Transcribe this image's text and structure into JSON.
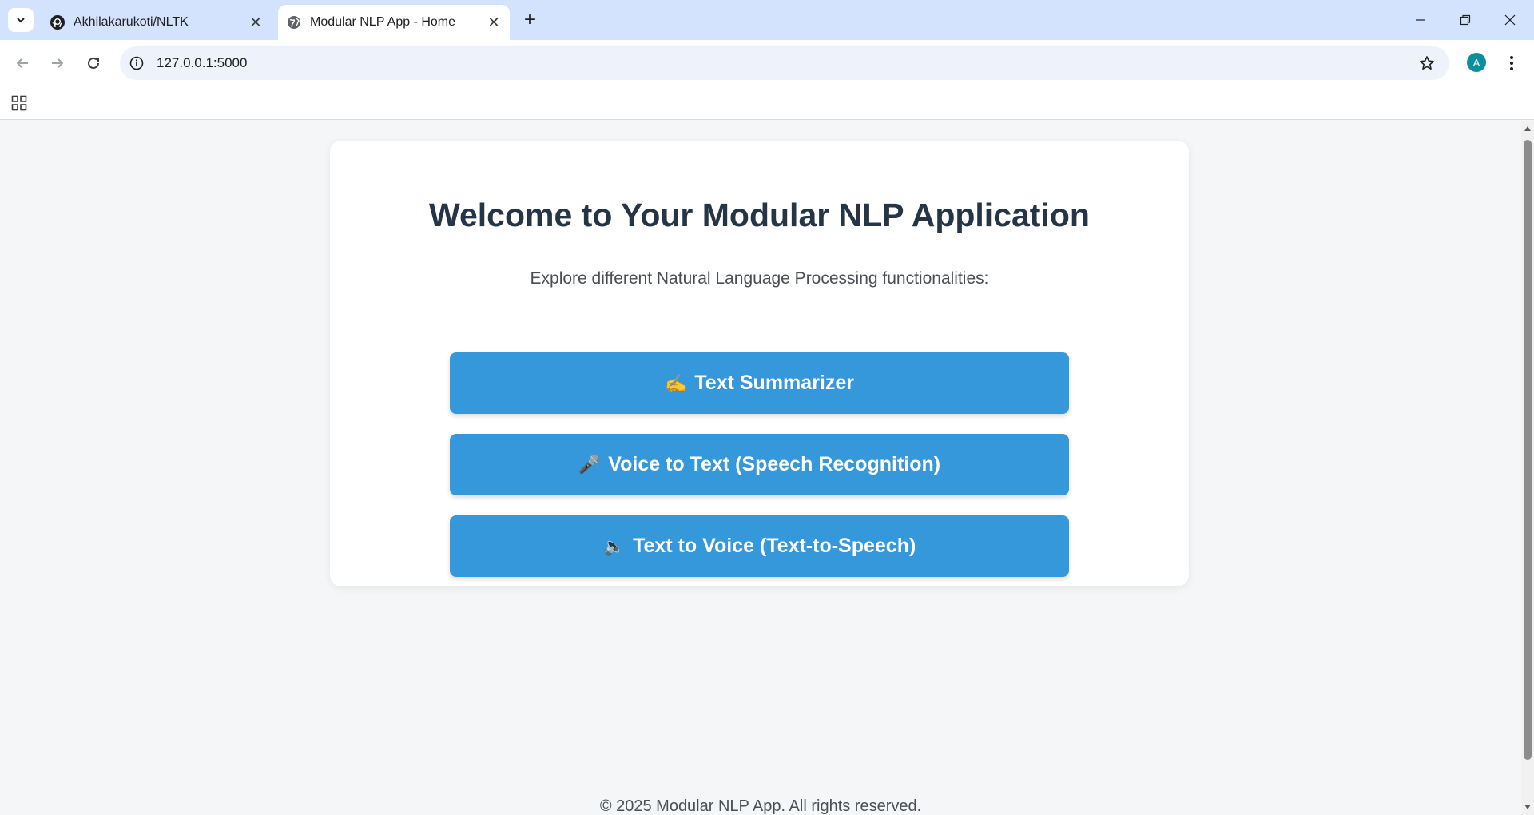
{
  "browser": {
    "tabs": [
      {
        "title": "Akhilakarukoti/NLTK",
        "icon": "github-icon",
        "active": false
      },
      {
        "title": "Modular NLP App - Home",
        "icon": "globe-icon",
        "active": true
      }
    ],
    "url": "127.0.0.1:5000",
    "profile_initial": "A",
    "profile_color": "#0b8f9e"
  },
  "page": {
    "heading": "Welcome to Your Modular NLP Application",
    "subtitle": "Explore different Natural Language Processing functionalities:",
    "features": [
      {
        "emoji": "✍️",
        "label": "Text Summarizer"
      },
      {
        "emoji": "🎤",
        "label": "Voice to Text (Speech Recognition)"
      },
      {
        "emoji": "🔈",
        "label": "Text to Voice (Text-to-Speech)"
      }
    ],
    "footer": "© 2025 Modular NLP App. All rights reserved.",
    "accent_color": "#3598db"
  }
}
